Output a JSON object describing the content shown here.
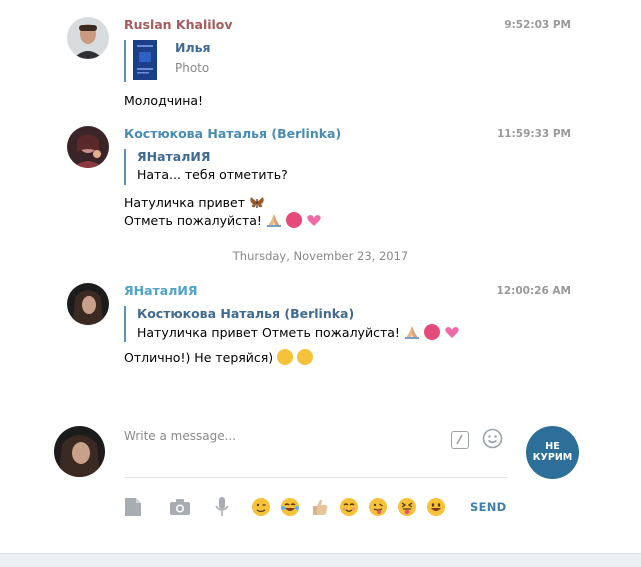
{
  "messages": [
    {
      "sender": "Ruslan Khalilov",
      "sender_color": "#a45b5b",
      "time": "9:52:03 PM",
      "quote": {
        "name": "Илья",
        "text": "Photo"
      },
      "lines": [
        "Молодчина!"
      ]
    },
    {
      "sender": "Костюкова Наталья (Berlinka)",
      "sender_color": "#4a8bb4",
      "time": "11:59:33 PM",
      "quote": {
        "name": "ЯНаталИЯ",
        "text": "Ната... тебя отметить?"
      },
      "lines": [
        "Натуличка привет",
        "Отметь пожалуйста!"
      ]
    },
    {
      "sender": "ЯНаталИЯ",
      "sender_color": "#4fa3c9",
      "time": "12:00:26 AM",
      "quote": {
        "name": "Костюкова Наталья (Berlinka)",
        "text": "Натуличка привет  Отметь пожалуйста!"
      },
      "lines": [
        "Отлично!) Не теряйся)"
      ]
    }
  ],
  "date_separator": "Thursday, November 23, 2017",
  "composer": {
    "placeholder": "Write a message...",
    "channel_label_1": "НЕ",
    "channel_label_2": "КУРИМ",
    "send_label": "SEND"
  },
  "icons": {
    "attach": "file-icon",
    "camera": "camera-icon",
    "mic": "microphone-icon",
    "commands": "slash-command-icon",
    "emoji": "smile-icon"
  }
}
